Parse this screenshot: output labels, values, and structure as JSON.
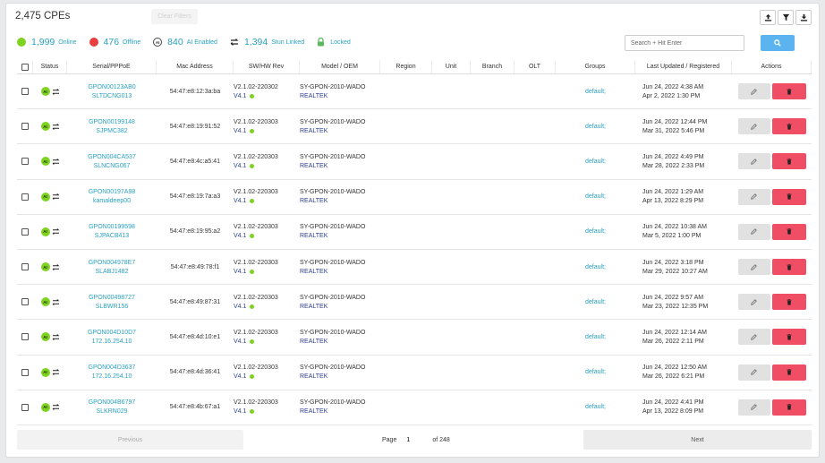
{
  "header": {
    "title": "2,475 CPEs",
    "ghost_button": "Clear Filters"
  },
  "stats": {
    "online_count": "1,999",
    "online_label": "Online",
    "offline_count": "476",
    "offline_label": "Offline",
    "ai_badge": "AI",
    "ai_count": "840",
    "ai_label": "AI Enabled",
    "stun_count": "1,394",
    "stun_label": "Stun Linked",
    "locked_label": "Locked"
  },
  "search": {
    "placeholder": "Search + Hit Enter"
  },
  "columns": [
    "Status",
    "Serial/PPPoE",
    "Mac Address",
    "SW/HW Rev",
    "Model / OEM",
    "Region",
    "Unit",
    "Branch",
    "OLT",
    "Groups",
    "Last Updated / Registered",
    "Actions"
  ],
  "rows": [
    {
      "ai": "AI",
      "serial": "GPON00123AB0",
      "pppoe": "SLTDCNG013",
      "mac": "54:47:e8:12:3a:ba",
      "sw": "V2.1.02-220302",
      "hw": "V4.1",
      "model": "SY-GPON-2010-WADO",
      "oem": "REALTEK",
      "group": "default;",
      "updated": "Jun 24, 2022 4:38 AM",
      "registered": "Apr 2, 2022 1:30 PM"
    },
    {
      "ai": "AI",
      "serial": "GPON00199148",
      "pppoe": "SJPMC382",
      "mac": "54:47:e8:19:91:52",
      "sw": "V2.1.02-220303",
      "hw": "V4.1",
      "model": "SY-GPON-2010-WADO",
      "oem": "REALTEK",
      "group": "default;",
      "updated": "Jun 24, 2022 12:44 PM",
      "registered": "Mar 31, 2022 5:46 PM"
    },
    {
      "ai": "AI",
      "serial": "GPON004CA537",
      "pppoe": "SLNCNG067",
      "mac": "54:47:e8:4c:a5:41",
      "sw": "V2.1.02-220303",
      "hw": "V4.1",
      "model": "SY-GPON-2010-WADO",
      "oem": "REALTEK",
      "group": "default;",
      "updated": "Jun 24, 2022 4:49 PM",
      "registered": "Mar 28, 2022 2:33 PM"
    },
    {
      "ai": "AI",
      "serial": "GPON00197A98",
      "pppoe": "kamaldeep00",
      "mac": "54:47:e8:19:7a:a3",
      "sw": "V2.1.02-220303",
      "hw": "V4.1",
      "model": "SY-GPON-2010-WADO",
      "oem": "REALTEK",
      "group": "default;",
      "updated": "Jun 24, 2022 1:29 AM",
      "registered": "Apr 13, 2022 8:29 PM"
    },
    {
      "ai": "AI",
      "serial": "GPON00199598",
      "pppoe": "SJPACB413",
      "mac": "54:47:e8:19:95:a2",
      "sw": "V2.1.02-220303",
      "hw": "V4.1",
      "model": "SY-GPON-2010-WADO",
      "oem": "REALTEK",
      "group": "default;",
      "updated": "Jun 24, 2022 10:38 AM",
      "registered": "Mar 5, 2022 1:00 PM"
    },
    {
      "ai": "AI",
      "serial": "GPON004978E7",
      "pppoe": "SLABJ1482",
      "mac": "54:47:e8:49:78:f1",
      "sw": "V2.1.02-220303",
      "hw": "V4.1",
      "model": "SY-GPON-2010-WADO",
      "oem": "REALTEK",
      "group": "default;",
      "updated": "Jun 24, 2022 3:18 PM",
      "registered": "Mar 29, 2022 10:27 AM"
    },
    {
      "ai": "AI",
      "serial": "GPON00498727",
      "pppoe": "SLBWR156",
      "mac": "54:47:e8:49:87:31",
      "sw": "V2.1.02-220303",
      "hw": "V4.1",
      "model": "SY-GPON-2010-WADO",
      "oem": "REALTEK",
      "group": "default;",
      "updated": "Jun 24, 2022 9:57 AM",
      "registered": "Mar 23, 2022 12:35 PM"
    },
    {
      "ai": "AI",
      "serial": "GPON004D10D7",
      "pppoe": "172.16.254.10",
      "mac": "54:47:e8:4d:10:e1",
      "sw": "V2.1.02-220303",
      "hw": "V4.1",
      "model": "SY-GPON-2010-WADO",
      "oem": "REALTEK",
      "group": "default;",
      "updated": "Jun 24, 2022 12:14 AM",
      "registered": "Mar 26, 2022 2:11 PM"
    },
    {
      "ai": "AI",
      "serial": "GPON004D3637",
      "pppoe": "172.16.254.10",
      "mac": "54:47:e8:4d:36:41",
      "sw": "V2.1.02-220303",
      "hw": "V4.1",
      "model": "SY-GPON-2010-WADO",
      "oem": "REALTEK",
      "group": "default;",
      "updated": "Jun 24, 2022 12:50 AM",
      "registered": "Mar 26, 2022 6:21 PM"
    },
    {
      "ai": "AI",
      "serial": "GPON004B6797",
      "pppoe": "SLKRN029",
      "mac": "54:47:e8:4b:67:a1",
      "sw": "V2.1.02-220303",
      "hw": "V4.1",
      "model": "SY-GPON-2010-WADO",
      "oem": "REALTEK",
      "group": "default;",
      "updated": "Jun 24, 2022 4:41 PM",
      "registered": "Apr 13, 2022 8:09 PM"
    }
  ],
  "pagination": {
    "previous_label": "Previous",
    "page_label": "Page",
    "current_page": "1",
    "total_pages": "of 248",
    "next_label": "Next"
  },
  "colors": {
    "accent_link": "#2aa1c0",
    "online": "#7ed321",
    "offline": "#e83e3e",
    "delete": "#f04e64",
    "search_button": "#5bb4f0"
  }
}
